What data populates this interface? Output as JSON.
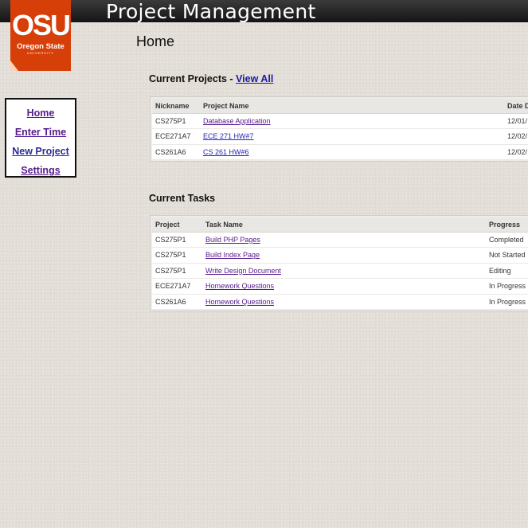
{
  "app": {
    "title": "Project Management"
  },
  "logo": {
    "mark": "OSU",
    "line1": "Oregon State",
    "line2": "UNIVERSITY"
  },
  "page": {
    "title": "Home"
  },
  "nav": {
    "items": [
      {
        "label": "Home"
      },
      {
        "label": "Enter Time"
      },
      {
        "label": "New Project"
      },
      {
        "label": "Settings"
      }
    ]
  },
  "projects": {
    "heading": "Current Projects - ",
    "view_all": "View All",
    "columns": [
      "Nickname",
      "Project Name",
      "Date D"
    ],
    "rows": [
      {
        "nickname": "CS275P1",
        "name": "Database Application",
        "date": "12/01/"
      },
      {
        "nickname": "ECE271A7",
        "name": "ECE 271 HW#7",
        "date": "12/02/"
      },
      {
        "nickname": "CS261A6",
        "name": "CS 261 HW#6",
        "date": "12/02/"
      }
    ]
  },
  "tasks": {
    "heading": "Current Tasks",
    "columns": [
      "Project",
      "Task Name",
      "Progress"
    ],
    "rows": [
      {
        "project": "CS275P1",
        "name": "Build PHP Pages",
        "progress": "Completed"
      },
      {
        "project": "CS275P1",
        "name": "Build Index Page",
        "progress": "Not Started"
      },
      {
        "project": "CS275P1",
        "name": "Write Design Document",
        "progress": "Editing"
      },
      {
        "project": "ECE271A7",
        "name": "Homework Questions",
        "progress": "In Progress"
      },
      {
        "project": "CS261A6",
        "name": "Homework Questions",
        "progress": "In Progress"
      }
    ]
  }
}
